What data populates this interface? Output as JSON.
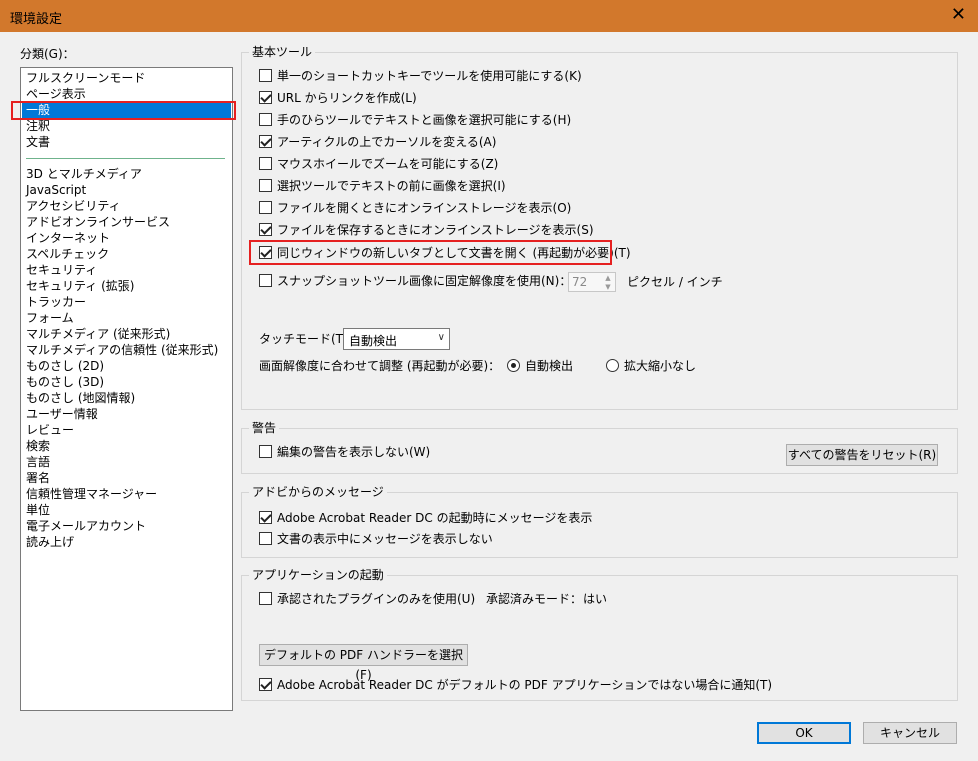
{
  "window": {
    "title": "環境設定",
    "close_glyph": "✕"
  },
  "categories": {
    "label": "分類(G)：",
    "items_top": [
      "フルスクリーンモード",
      "ページ表示",
      "一般",
      "注釈",
      "文書"
    ],
    "selected": "一般",
    "items_bottom": [
      "3D とマルチメディア",
      "JavaScript",
      "アクセシビリティ",
      "アドビオンラインサービス",
      "インターネット",
      "スペルチェック",
      "セキュリティ",
      "セキュリティ (拡張)",
      "トラッカー",
      "フォーム",
      "マルチメディア (従来形式)",
      "マルチメディアの信頼性 (従来形式)",
      "ものさし (2D)",
      "ものさし (3D)",
      "ものさし (地図情報)",
      "ユーザー情報",
      "レビュー",
      "検索",
      "言語",
      "署名",
      "信頼性管理マネージャー",
      "単位",
      "電子メールアカウント",
      "読み上げ"
    ]
  },
  "basic_tools": {
    "title": "基本ツール",
    "options": [
      {
        "label": "単一のショートカットキーでツールを使用可能にする(K)",
        "checked": false
      },
      {
        "label": "URL からリンクを作成(L)",
        "checked": true
      },
      {
        "label": "手のひらツールでテキストと画像を選択可能にする(H)",
        "checked": false
      },
      {
        "label": "アーティクルの上でカーソルを変える(A)",
        "checked": true
      },
      {
        "label": "マウスホイールでズームを可能にする(Z)",
        "checked": false
      },
      {
        "label": "選択ツールでテキストの前に画像を選択(I)",
        "checked": false
      },
      {
        "label": "ファイルを開くときにオンラインストレージを表示(O)",
        "checked": false
      },
      {
        "label": "ファイルを保存するときにオンラインストレージを表示(S)",
        "checked": true
      },
      {
        "label": "同じウィンドウの新しいタブとして文書を開く (再起動が必要)(T)",
        "checked": true
      },
      {
        "label": "スナップショットツール画像に固定解像度を使用(N)：",
        "checked": false
      }
    ],
    "resolution": {
      "value": "72",
      "unit": "ピクセル / インチ",
      "up": "▲",
      "down": "▼"
    },
    "touch_mode": {
      "label": "タッチモード(T)：",
      "value": "自動検出",
      "chevron": "∨"
    },
    "scale": {
      "label": "画面解像度に合わせて調整 (再起動が必要)：",
      "option_auto": "自動検出",
      "option_none": "拡大縮小なし",
      "selected": "auto"
    }
  },
  "warnings": {
    "title": "警告",
    "option": {
      "label": "編集の警告を表示しない(W)",
      "checked": false
    },
    "reset_button": "すべての警告をリセット(R)"
  },
  "messages": {
    "title": "アドビからのメッセージ",
    "options": [
      {
        "label": "Adobe Acrobat Reader DC の起動時にメッセージを表示",
        "checked": true
      },
      {
        "label": "文書の表示中にメッセージを表示しない",
        "checked": false
      }
    ]
  },
  "startup": {
    "title": "アプリケーションの起動",
    "plugins_option": {
      "label": "承認されたプラグインのみを使用(U)",
      "checked": false
    },
    "cert_mode_label": "承認済みモード：",
    "cert_mode_value": "はい",
    "pdf_handler_button": "デフォルトの PDF ハンドラーを選択(F)",
    "notify_option": {
      "label": "Adobe Acrobat Reader DC がデフォルトの PDF アプリケーションではない場合に通知(T)",
      "checked": true
    }
  },
  "footer": {
    "ok": "OK",
    "cancel": "キャンセル"
  }
}
